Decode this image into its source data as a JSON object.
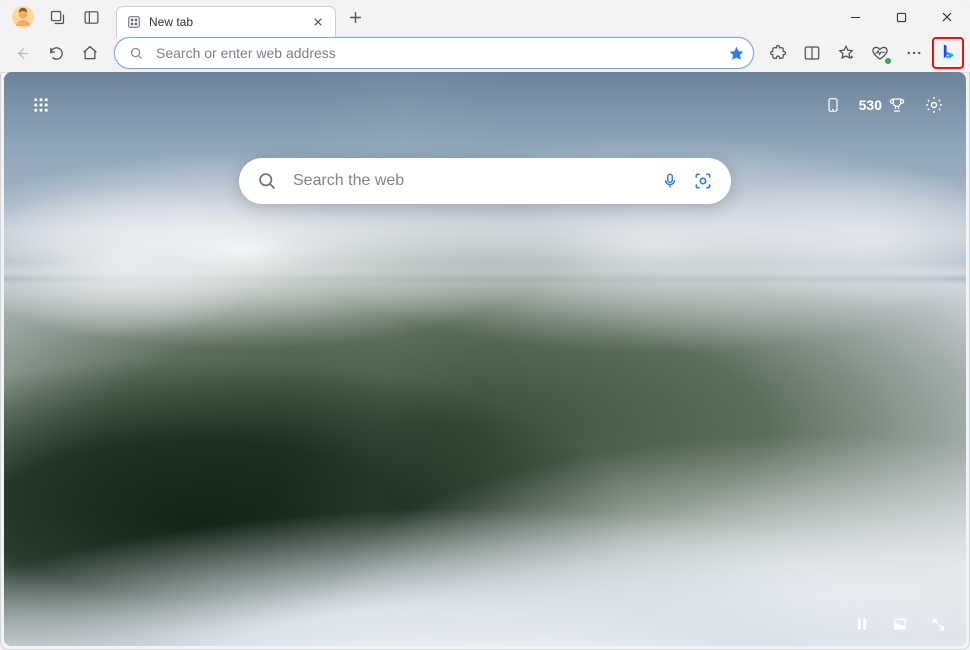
{
  "tab": {
    "title": "New tab"
  },
  "addressbar": {
    "placeholder": "Search or enter web address"
  },
  "ntp": {
    "search_placeholder": "Search the web",
    "rewards_points": "530"
  },
  "colors": {
    "accent": "#2b7de9",
    "highlight": "#e11"
  }
}
